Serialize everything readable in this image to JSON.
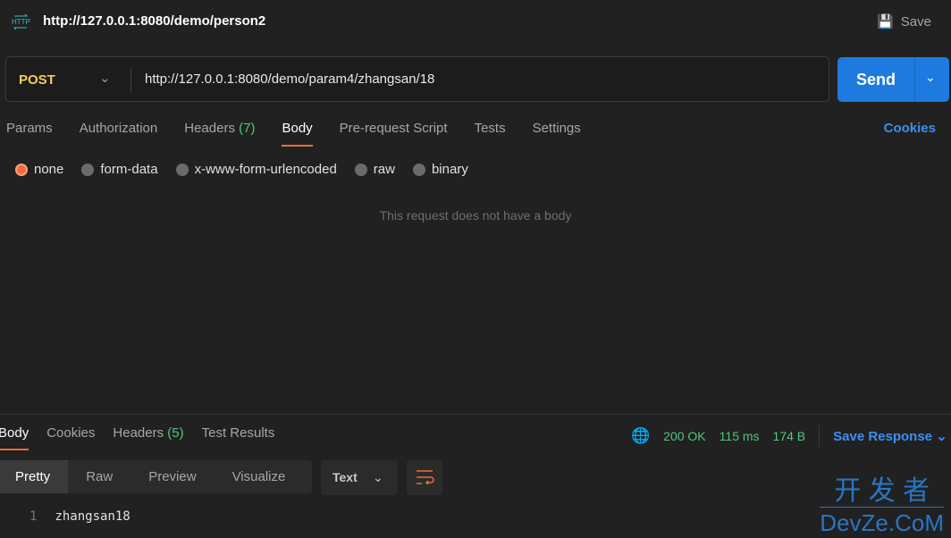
{
  "header": {
    "title": "http://127.0.0.1:8080/demo/person2",
    "save_label": "Save"
  },
  "request": {
    "method": "POST",
    "url": "http://127.0.0.1:8080/demo/param4/zhangsan/18",
    "send_label": "Send"
  },
  "tabs": [
    {
      "label": "Params"
    },
    {
      "label": "Authorization"
    },
    {
      "label": "Headers",
      "count": "(7)"
    },
    {
      "label": "Body"
    },
    {
      "label": "Pre-request Script"
    },
    {
      "label": "Tests"
    },
    {
      "label": "Settings"
    }
  ],
  "cookies_label": "Cookies",
  "body_types": [
    {
      "label": "none",
      "selected": true
    },
    {
      "label": "form-data"
    },
    {
      "label": "x-www-form-urlencoded"
    },
    {
      "label": "raw"
    },
    {
      "label": "binary"
    }
  ],
  "no_body_text": "This request does not have a body",
  "response": {
    "tabs": [
      {
        "label": "Body"
      },
      {
        "label": "Cookies"
      },
      {
        "label": "Headers",
        "count": "(5)"
      },
      {
        "label": "Test Results"
      }
    ],
    "status": "200 OK",
    "time": "115 ms",
    "size": "174 B",
    "save_label": "Save Response",
    "views": [
      "Pretty",
      "Raw",
      "Preview",
      "Visualize"
    ],
    "format": "Text",
    "lines": [
      {
        "n": "1",
        "text": "zhangsan18"
      }
    ]
  },
  "watermark": {
    "top": "开 发 者",
    "bottom": "DevZe.CoM"
  },
  "colors": {
    "accent": "#f26b3a",
    "send": "#1f7ae0",
    "method": "#f5cf5a",
    "status": "#4dc97a",
    "link": "#3d8ef0"
  }
}
